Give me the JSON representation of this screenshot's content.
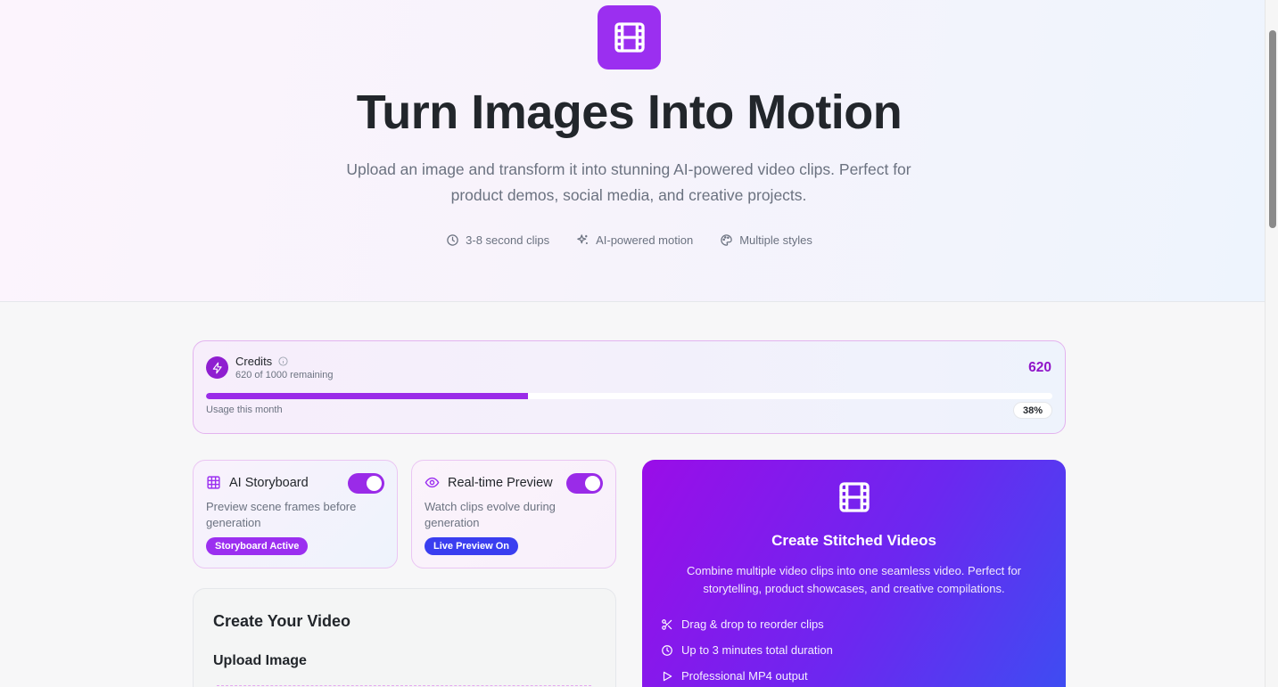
{
  "hero": {
    "title": "Turn Images Into Motion",
    "subtitle": "Upload an image and transform it into stunning AI-powered video clips. Perfect for product demos, social media, and creative projects.",
    "features": [
      {
        "icon": "clock-icon",
        "label": "3-8 second clips"
      },
      {
        "icon": "sparkles-icon",
        "label": "AI-powered motion"
      },
      {
        "icon": "palette-icon",
        "label": "Multiple styles"
      }
    ],
    "logo_icon": "film-icon",
    "accent_color": "#9b2ff0"
  },
  "credits": {
    "title": "Credits",
    "remaining_text": "620 of 1000 remaining",
    "count": "620",
    "usage_label": "Usage this month",
    "usage_percent_label": "38%",
    "progress_fraction": 0.38
  },
  "storyboard": {
    "title": "AI Storyboard",
    "description": "Preview scene frames before generation",
    "badge": "Storyboard Active",
    "enabled": true,
    "icon": "grid-icon"
  },
  "preview": {
    "title": "Real-time Preview",
    "description": "Watch clips evolve during generation",
    "badge": "Live Preview On",
    "enabled": true,
    "icon": "eye-icon"
  },
  "create": {
    "title": "Create Your Video",
    "upload_title": "Upload Image"
  },
  "stitch": {
    "title": "Create Stitched Videos",
    "description": "Combine multiple video clips into one seamless video. Perfect for storytelling, product showcases, and creative compilations.",
    "features": [
      {
        "icon": "scissors-icon",
        "label": "Drag & drop to reorder clips"
      },
      {
        "icon": "clock-icon",
        "label": "Up to 3 minutes total duration"
      },
      {
        "icon": "play-icon",
        "label": "Professional MP4 output"
      }
    ]
  }
}
